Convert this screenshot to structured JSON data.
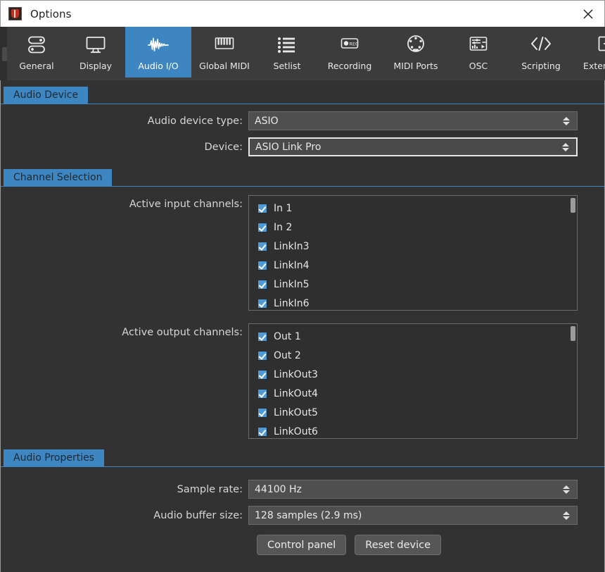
{
  "window": {
    "title": "Options",
    "app_icon": "cantabile-logo-icon",
    "close_icon": "close-icon"
  },
  "toolbar": {
    "tabs": [
      {
        "label": "General",
        "icon": "server-stack-icon",
        "selected": false
      },
      {
        "label": "Display",
        "icon": "monitor-icon",
        "selected": false
      },
      {
        "label": "Audio I/O",
        "icon": "waveform-icon",
        "selected": true
      },
      {
        "label": "Global MIDI",
        "icon": "piano-keys-icon",
        "selected": false
      },
      {
        "label": "Setlist",
        "icon": "list-icon",
        "selected": false
      },
      {
        "label": "Recording",
        "icon": "rec-button-icon",
        "selected": false
      },
      {
        "label": "MIDI Ports",
        "icon": "midi-din-icon",
        "selected": false
      },
      {
        "label": "OSC",
        "icon": "osc-mixer-icon",
        "selected": false
      },
      {
        "label": "Scripting",
        "icon": "code-brackets-icon",
        "selected": false
      },
      {
        "label": "Extensions",
        "icon": "plus-box-icon",
        "selected": false
      }
    ]
  },
  "sections": {
    "audio_device": {
      "title": "Audio Device",
      "device_type_label": "Audio device type:",
      "device_type_value": "ASIO",
      "device_label": "Device:",
      "device_value": "ASIO Link Pro"
    },
    "channel_selection": {
      "title": "Channel Selection",
      "input_label": "Active input channels:",
      "inputs": [
        {
          "label": "In 1",
          "checked": true
        },
        {
          "label": "In 2",
          "checked": true
        },
        {
          "label": "LinkIn3",
          "checked": true
        },
        {
          "label": "LinkIn4",
          "checked": true
        },
        {
          "label": "LinkIn5",
          "checked": true
        },
        {
          "label": "LinkIn6",
          "checked": true
        }
      ],
      "output_label": "Active output channels:",
      "outputs": [
        {
          "label": "Out 1",
          "checked": true
        },
        {
          "label": "Out 2",
          "checked": true
        },
        {
          "label": "LinkOut3",
          "checked": true
        },
        {
          "label": "LinkOut4",
          "checked": true
        },
        {
          "label": "LinkOut5",
          "checked": true
        },
        {
          "label": "LinkOut6",
          "checked": true
        }
      ]
    },
    "audio_properties": {
      "title": "Audio Properties",
      "sample_rate_label": "Sample rate:",
      "sample_rate_value": "44100 Hz",
      "buffer_label": "Audio buffer size:",
      "buffer_value": "128 samples (2.9 ms)",
      "control_panel_button": "Control panel",
      "reset_device_button": "Reset device"
    }
  },
  "colors": {
    "accent": "#3e86c1",
    "window_bg": "#323232",
    "toolbar_bg": "#3c3c3c",
    "titlebar_bg": "#ffffff",
    "check_blue": "#4f9ad4"
  }
}
